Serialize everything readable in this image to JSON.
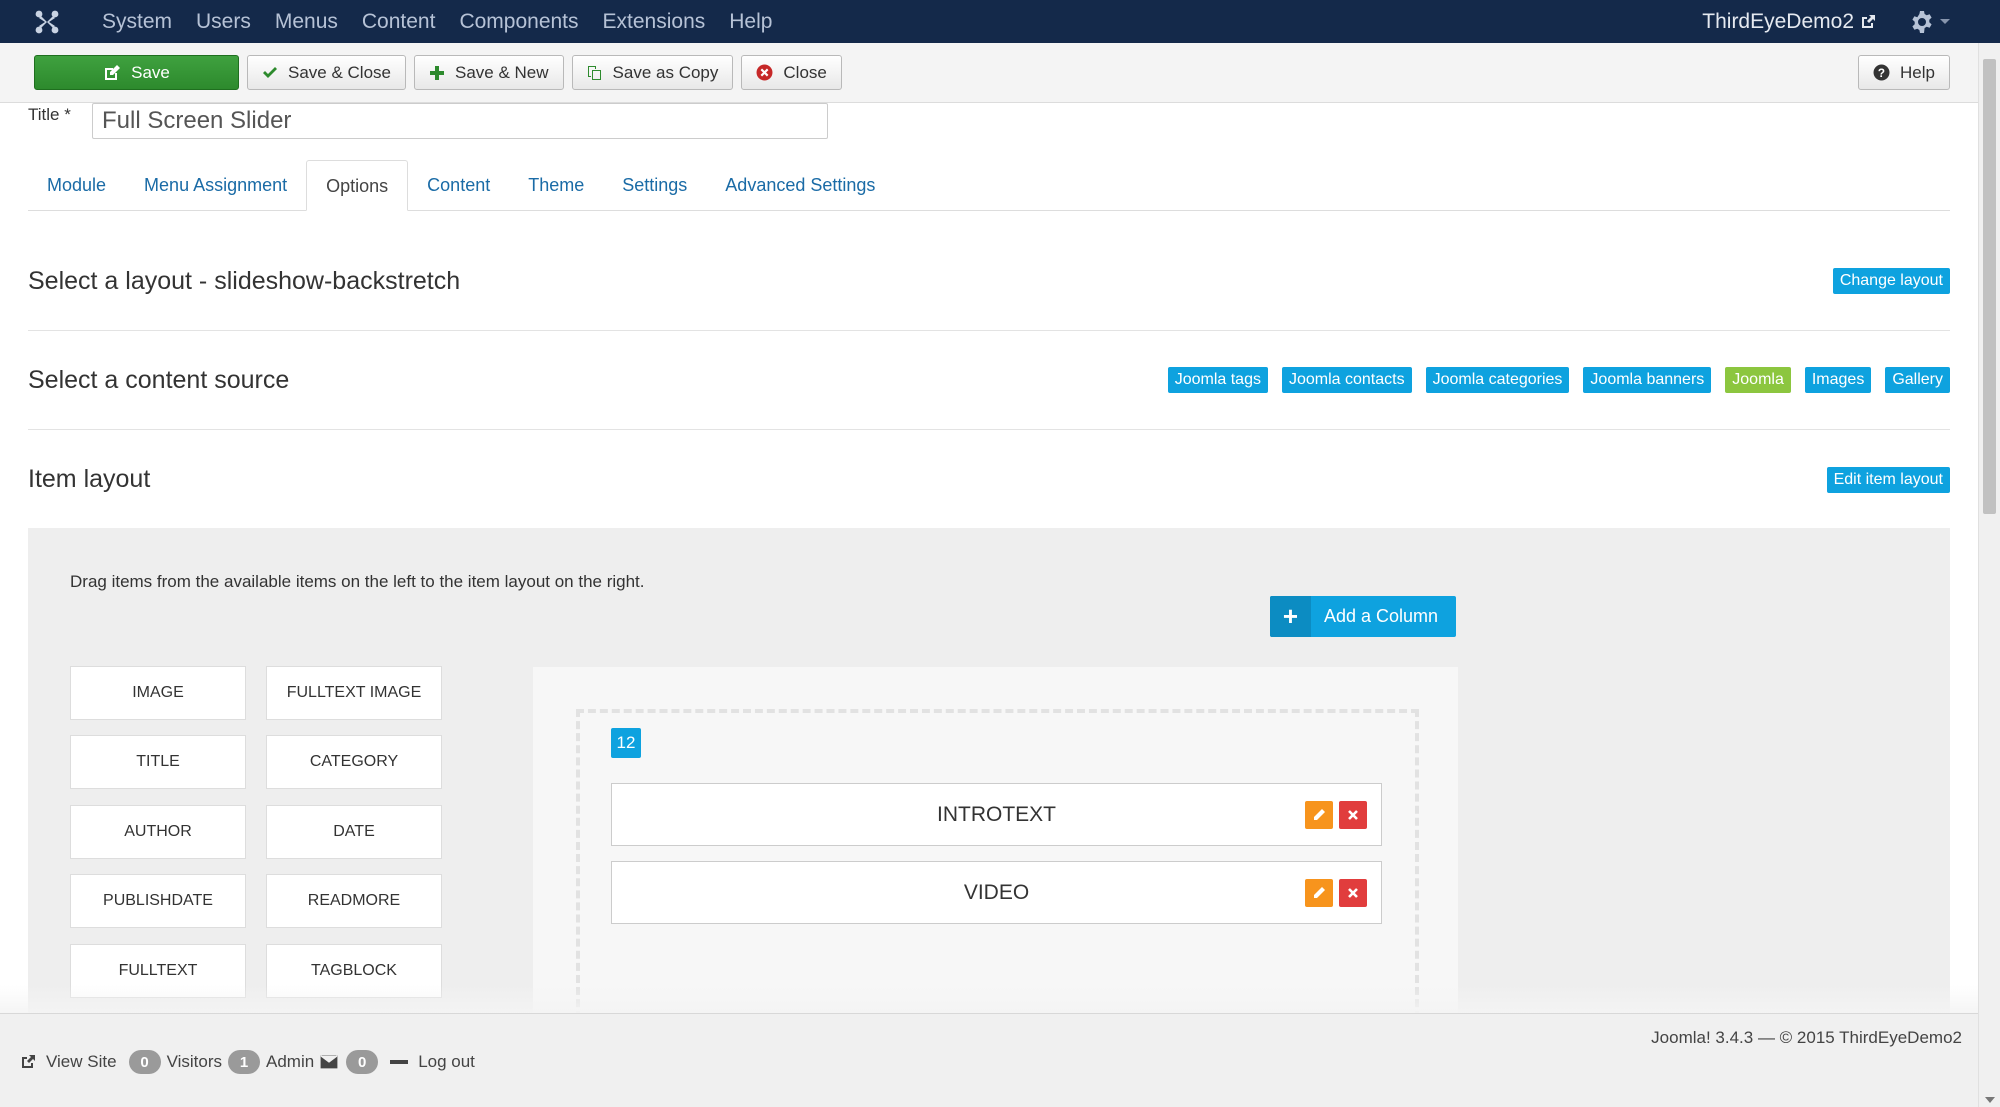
{
  "navbar": {
    "menu": [
      "System",
      "Users",
      "Menus",
      "Content",
      "Components",
      "Extensions",
      "Help"
    ],
    "site_name": "ThirdEyeDemo2"
  },
  "toolbar": {
    "save": "Save",
    "save_close": "Save & Close",
    "save_new": "Save & New",
    "save_copy": "Save as Copy",
    "close": "Close",
    "help": "Help"
  },
  "form": {
    "title_label": "Title *",
    "title_value": "Full Screen Slider"
  },
  "tabs": [
    {
      "label": "Module",
      "active": false
    },
    {
      "label": "Menu Assignment",
      "active": false
    },
    {
      "label": "Options",
      "active": true
    },
    {
      "label": "Content",
      "active": false
    },
    {
      "label": "Theme",
      "active": false
    },
    {
      "label": "Settings",
      "active": false
    },
    {
      "label": "Advanced Settings",
      "active": false
    }
  ],
  "layout_section": {
    "title": "Select a layout - slideshow-backstretch",
    "button": "Change layout"
  },
  "source_section": {
    "title": "Select a content source",
    "sources": [
      "Joomla tags",
      "Joomla contacts",
      "Joomla categories",
      "Joomla banners",
      "Joomla",
      "Images",
      "Gallery"
    ],
    "active_source": "Joomla"
  },
  "item_layout_section": {
    "title": "Item layout",
    "button": "Edit item layout"
  },
  "builder": {
    "hint": "Drag items from the available items on the left to the item layout on the right.",
    "add_column": "Add a Column",
    "available_items": [
      "IMAGE",
      "FULLTEXT IMAGE",
      "TITLE",
      "CATEGORY",
      "AUTHOR",
      "DATE",
      "PUBLISHDATE",
      "READMORE",
      "FULLTEXT",
      "TAGBLOCK"
    ],
    "column_width": "12",
    "layout_items": [
      "INTROTEXT",
      "VIDEO"
    ]
  },
  "footer": {
    "view_site": "View Site",
    "visitors_count": "0",
    "visitors_label": "Visitors",
    "admin_count": "1",
    "admin_label": "Admin",
    "messages_count": "0",
    "logout": "Log out",
    "version": "Joomla! 3.4.3  —  © 2015 ThirdEyeDemo2"
  },
  "colors": {
    "navbar_bg": "#14294a",
    "save_green": "#2d8a2d",
    "label_blue": "#0ea2df",
    "label_green": "#8cc63f",
    "edit_orange": "#f7941d",
    "delete_red": "#e13d3d"
  },
  "icons": [
    "joomla-logo-icon",
    "external-link-icon",
    "gear-icon",
    "edit-icon",
    "check-icon",
    "plus-icon",
    "copy-icon",
    "close-circle-icon",
    "question-icon",
    "pencil-icon",
    "remove-icon",
    "mail-icon",
    "minus-icon"
  ]
}
